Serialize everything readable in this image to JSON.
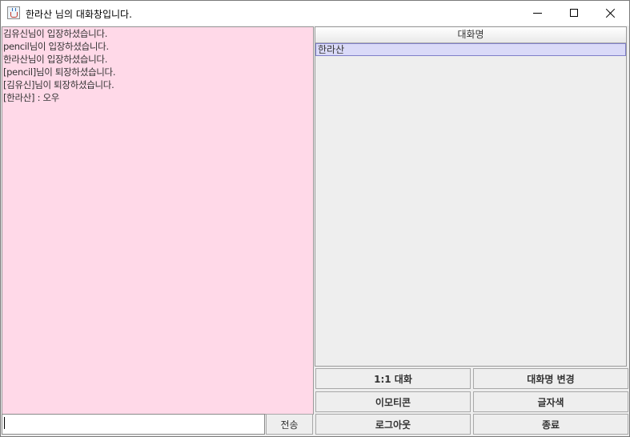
{
  "window": {
    "title": "한라산 님의 대화창입니다.",
    "icon": "java-cup-icon",
    "controls": [
      "minimize",
      "maximize",
      "close"
    ]
  },
  "chat": {
    "background": "#ffd9e8",
    "lines": [
      "김유신님이 입장하셨습니다.",
      "pencil님이 입장하셨습니다.",
      "한라산님이 입장하셨습니다.",
      "[pencil]님이 퇴장하셨습니다.",
      "[김유신]님이 퇴장하셨습니다.",
      "[한라산] : 오우"
    ],
    "input_value": "",
    "send_label": "전송"
  },
  "users": {
    "column_header": "대화명",
    "rows": [
      "한라산"
    ],
    "selected_row": 0,
    "selection_color": "#dadaf8"
  },
  "buttons": {
    "private_chat": "1:1 대화",
    "change_nickname": "대화명 변경",
    "emoticon": "이모티콘",
    "font_color": "글자색",
    "logout": "로그아웃",
    "exit": "종료"
  }
}
